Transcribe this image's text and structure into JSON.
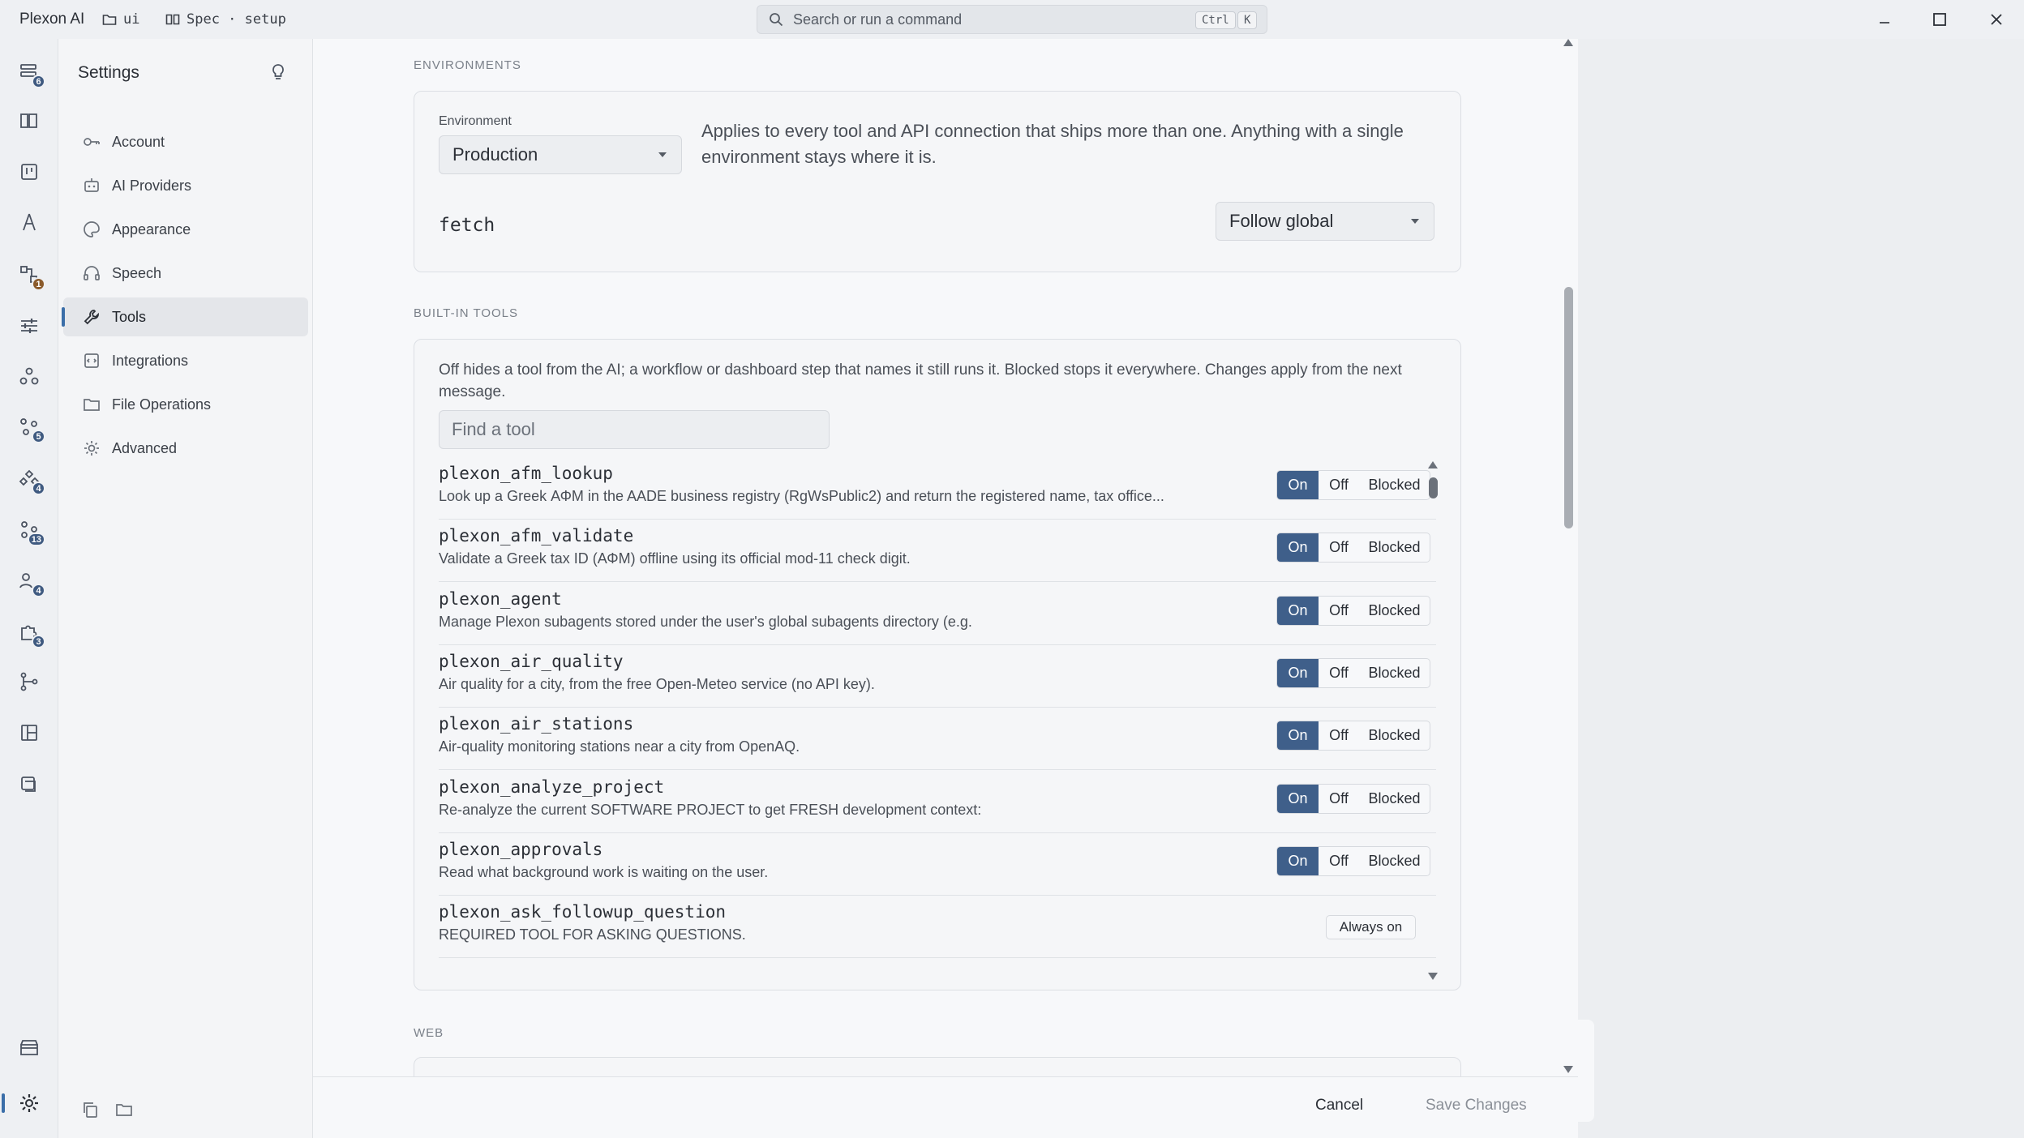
{
  "app": {
    "name": "Plexon AI",
    "crumb_folder": "ui",
    "crumb_spec": "Spec · setup",
    "search_placeholder": "Search or run a command",
    "kbd_ctrl": "Ctrl",
    "kbd_k": "K"
  },
  "rail": {
    "badges": [
      "6",
      "1",
      "5",
      "4",
      "13",
      "4",
      "3"
    ]
  },
  "settings": {
    "title": "Settings",
    "nav": [
      {
        "label": "Account",
        "icon": "key-icon"
      },
      {
        "label": "AI Providers",
        "icon": "robot-icon"
      },
      {
        "label": "Appearance",
        "icon": "palette-icon"
      },
      {
        "label": "Speech",
        "icon": "headphones-icon"
      },
      {
        "label": "Tools",
        "icon": "wrench-icon",
        "active": true
      },
      {
        "label": "Integrations",
        "icon": "plug-icon"
      },
      {
        "label": "File Operations",
        "icon": "folder-icon"
      },
      {
        "label": "Advanced",
        "icon": "gear-icon"
      }
    ]
  },
  "environments": {
    "section_label": "ENVIRONMENTS",
    "field_label": "Environment",
    "selected": "Production",
    "description": "Applies to every tool and API connection that ships more than one. Anything with a single environment stays where it is.",
    "fetch_label": "fetch",
    "fetch_selected": "Follow global"
  },
  "builtin_tools": {
    "section_label": "BUILT-IN TOOLS",
    "description": "Off hides a tool from the AI; a workflow or dashboard step that names it still runs it. Blocked stops it everywhere. Changes apply from the next message.",
    "find_placeholder": "Find a tool",
    "option_on": "On",
    "option_off": "Off",
    "option_blocked": "Blocked",
    "always_on_label": "Always on",
    "tools": [
      {
        "name": "plexon_afm_lookup",
        "desc": "Look up a Greek ΑΦΜ in the AADE business registry (RgWsPublic2) and return the registered name, tax office...",
        "state": "On"
      },
      {
        "name": "plexon_afm_validate",
        "desc": "Validate a Greek tax ID (ΑΦΜ) offline using its official mod-11 check digit.",
        "state": "On"
      },
      {
        "name": "plexon_agent",
        "desc": "Manage Plexon subagents stored under the user's global subagents directory (e.g.",
        "state": "On"
      },
      {
        "name": "plexon_air_quality",
        "desc": "Air quality for a city, from the free Open-Meteo service (no API key).",
        "state": "On"
      },
      {
        "name": "plexon_air_stations",
        "desc": "Air-quality monitoring stations near a city from OpenAQ.",
        "state": "On"
      },
      {
        "name": "plexon_analyze_project",
        "desc": "Re-analyze the current SOFTWARE PROJECT to get FRESH development context:",
        "state": "On"
      },
      {
        "name": "plexon_approvals",
        "desc": "Read what background work is waiting on the user.",
        "state": "On"
      },
      {
        "name": "plexon_ask_followup_question",
        "desc": "REQUIRED TOOL FOR ASKING QUESTIONS.",
        "state": "Always on"
      }
    ]
  },
  "web": {
    "section_label": "WEB"
  },
  "footer": {
    "cancel_label": "Cancel",
    "save_label": "Save Changes"
  }
}
